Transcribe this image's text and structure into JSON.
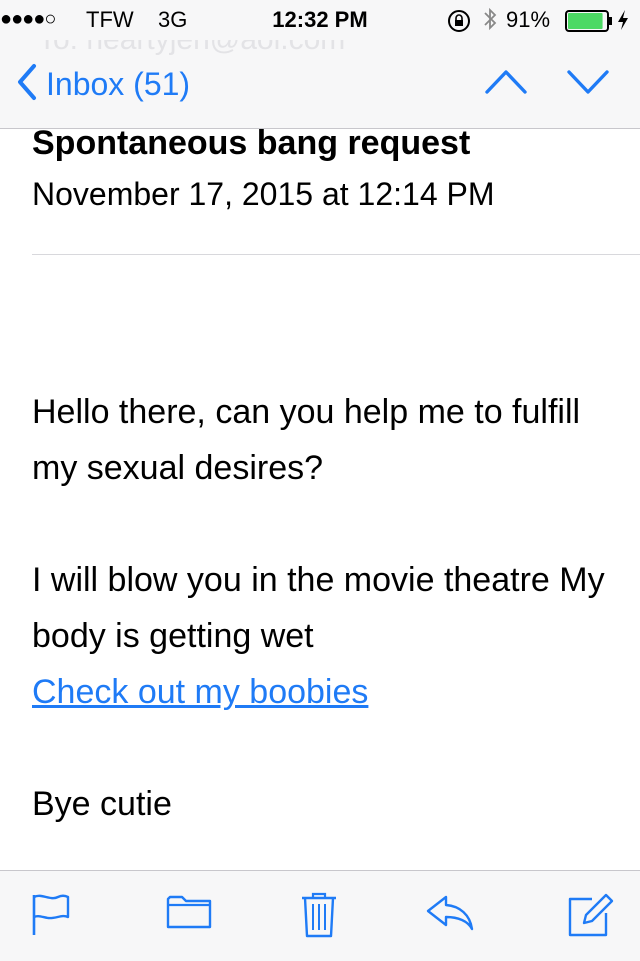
{
  "status_bar": {
    "signal": "●●●●○",
    "carrier": "TFW",
    "network": "3G",
    "time": "12:32 PM",
    "battery_percent": "91%",
    "battery_level": 0.91
  },
  "nav": {
    "ghost_to": "To: heartyjen@aol.com",
    "back_label": "Inbox (51)"
  },
  "message": {
    "subject": "Spontaneous bang request",
    "date": "November 17, 2015 at 12:14 PM",
    "para1": "Hello there, can you help me to fulfill my sexual desires?",
    "para2": "I will blow you in the movie theatre My body is getting wet",
    "link_text": "Check out my boobies",
    "para3": "Bye cutie"
  },
  "toolbar": {
    "items": [
      "flag-icon",
      "folder-icon",
      "trash-icon",
      "reply-icon",
      "compose-icon"
    ]
  },
  "colors": {
    "accent": "#1f7bf6",
    "bar_background": "#f7f7f8",
    "battery_fill": "#4cd964"
  }
}
